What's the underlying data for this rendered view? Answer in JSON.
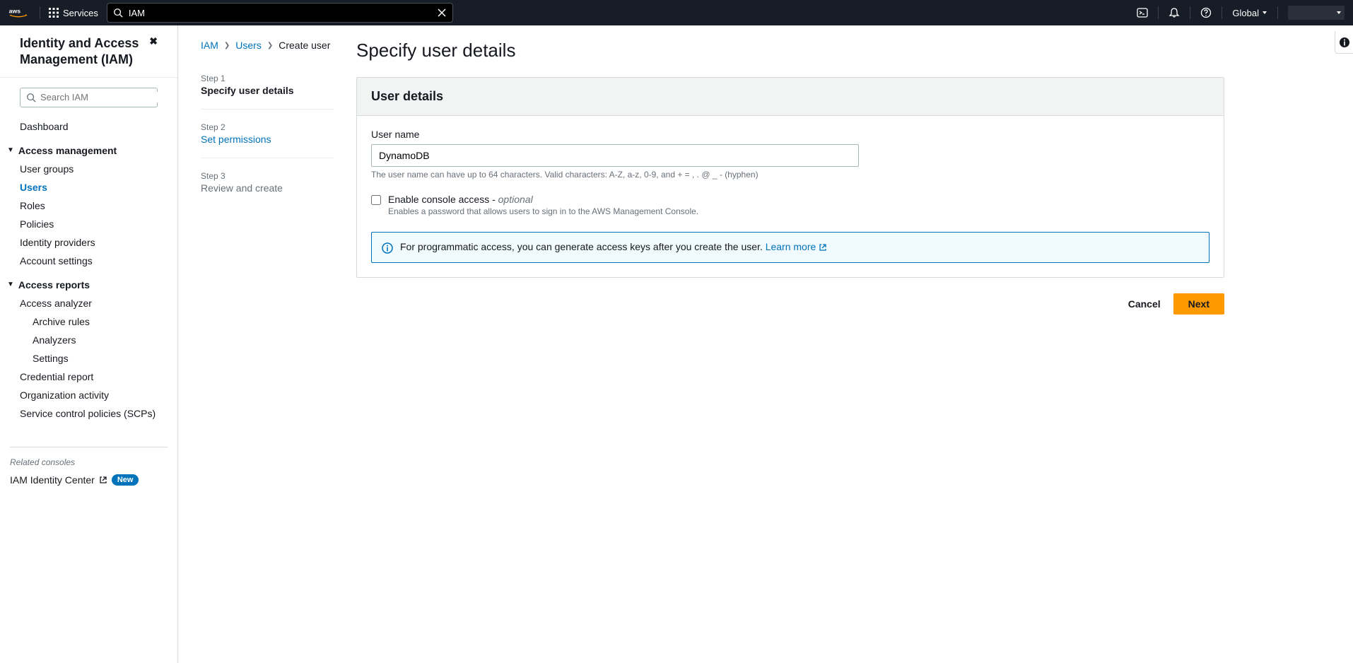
{
  "topbar": {
    "services_label": "Services",
    "search_value": "IAM",
    "region": "Global"
  },
  "sidebar": {
    "title": "Identity and Access Management (IAM)",
    "search_placeholder": "Search IAM",
    "dashboard": "Dashboard",
    "section_access_mgmt": "Access management",
    "items_access": [
      "User groups",
      "Users",
      "Roles",
      "Policies",
      "Identity providers",
      "Account settings"
    ],
    "section_reports": "Access reports",
    "items_reports": [
      "Access analyzer"
    ],
    "items_analyzer_sub": [
      "Archive rules",
      "Analyzers",
      "Settings"
    ],
    "items_reports_rest": [
      "Credential report",
      "Organization activity",
      "Service control policies (SCPs)"
    ],
    "related_title": "Related consoles",
    "related_link": "IAM Identity Center",
    "badge_new": "New"
  },
  "breadcrumb": {
    "iam": "IAM",
    "users": "Users",
    "create": "Create user"
  },
  "steps": {
    "s1_label": "Step 1",
    "s1_title": "Specify user details",
    "s2_label": "Step 2",
    "s2_title": "Set permissions",
    "s3_label": "Step 3",
    "s3_title": "Review and create"
  },
  "main": {
    "heading": "Specify user details",
    "panel_title": "User details",
    "username_label": "User name",
    "username_value": "DynamoDB",
    "username_hint": "The user name can have up to 64 characters. Valid characters: A-Z, a-z, 0-9, and + = , . @ _ - (hyphen)",
    "console_label": "Enable console access - ",
    "console_optional": "optional",
    "console_hint": "Enables a password that allows users to sign in to the AWS Management Console.",
    "info_text": "For programmatic access, you can generate access keys after you create the user. ",
    "info_link": "Learn more",
    "cancel": "Cancel",
    "next": "Next"
  }
}
